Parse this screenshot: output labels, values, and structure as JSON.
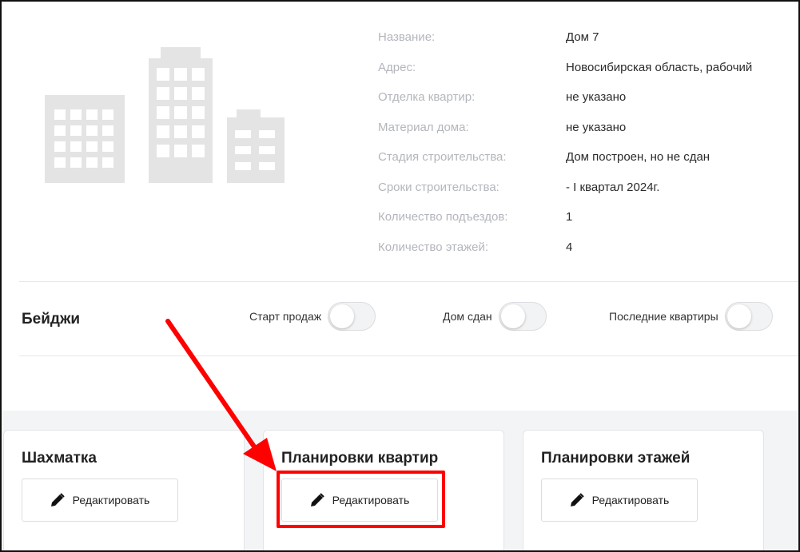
{
  "house": {
    "details": [
      {
        "label": "Название:",
        "value": "Дом 7"
      },
      {
        "label": "Адрес:",
        "value": "Новосибирская область, рабочий"
      },
      {
        "label": "Отделка квартир:",
        "value": "не указано"
      },
      {
        "label": "Материал дома:",
        "value": "не указано"
      },
      {
        "label": "Стадия строительства:",
        "value": "Дом построен, но не сдан"
      },
      {
        "label": "Сроки строительства:",
        "value": "- I квартал 2024г."
      },
      {
        "label": "Количество подъездов:",
        "value": "1"
      },
      {
        "label": "Количество этажей:",
        "value": "4"
      }
    ]
  },
  "badges": {
    "title": "Бейджи",
    "items": [
      {
        "label": "Старт продаж",
        "enabled": false
      },
      {
        "label": "Дом сдан",
        "enabled": false
      },
      {
        "label": "Последние квартиры",
        "enabled": false
      }
    ]
  },
  "cards": [
    {
      "title": "Шахматка",
      "button": "Редактировать"
    },
    {
      "title": "Планировки квартир",
      "button": "Редактировать"
    },
    {
      "title": "Планировки этажей",
      "button": "Редактировать"
    }
  ],
  "colors": {
    "highlight": "#ff0000",
    "placeholder_building": "#e4e4e4",
    "label_gray": "#b3b6bc"
  },
  "icons": {
    "building": "building-placeholder-icon",
    "edit": "pencil-icon",
    "annotation": "red-arrow-annotation"
  }
}
